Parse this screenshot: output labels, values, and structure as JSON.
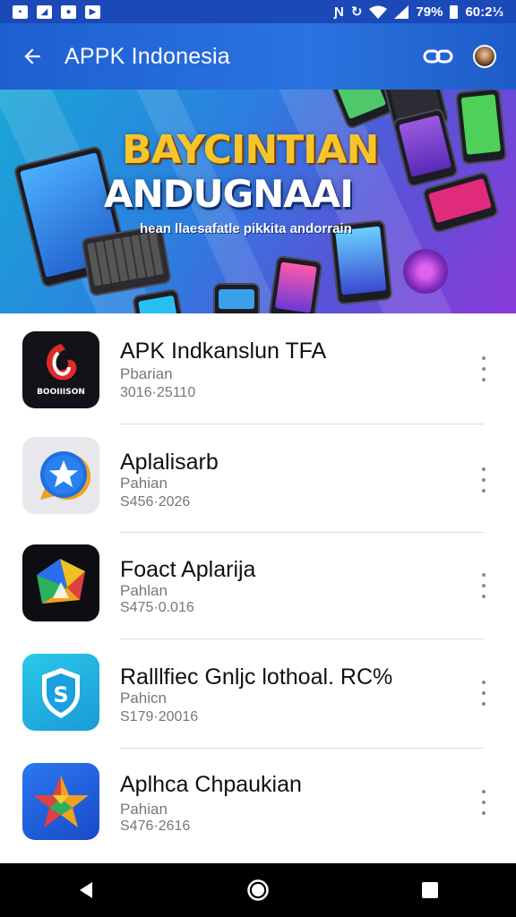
{
  "status_bar": {
    "battery": "79%",
    "time": "60:2⅓"
  },
  "app_bar": {
    "title": "APPK Indonesia"
  },
  "banner": {
    "headline_1": "BAYCINTIAN",
    "headline_2": "ANDUGNAAI",
    "subtitle": "hean llaesafatle pikkita andorrain"
  },
  "apps": [
    {
      "name": "APK Indkanslun TFA",
      "sub": "Pbarian",
      "meta": "3016·25110",
      "icon": "red-swirl-logo-icon"
    },
    {
      "name": "Aplalisarb",
      "sub": "Pahian",
      "meta": "S456·2026",
      "icon": "blue-star-chat-icon"
    },
    {
      "name": "Foact Aplarija",
      "sub": "Pahlan",
      "meta": "S475·0.016",
      "icon": "colorful-cube-icon"
    },
    {
      "name": "Ralllfiec Gnljc lothoal. RC%",
      "sub": "Pahicn",
      "meta": "S179·20016",
      "icon": "shield-icon"
    },
    {
      "name": "Aplhca Chpaukian",
      "sub": "Pahian",
      "meta": "S476·2616",
      "icon": "colorful-star-icon"
    }
  ],
  "colors": {
    "app_bar": "#2a73e0",
    "status_bar": "#1b49b8",
    "headline_1": "#f7c52a"
  }
}
